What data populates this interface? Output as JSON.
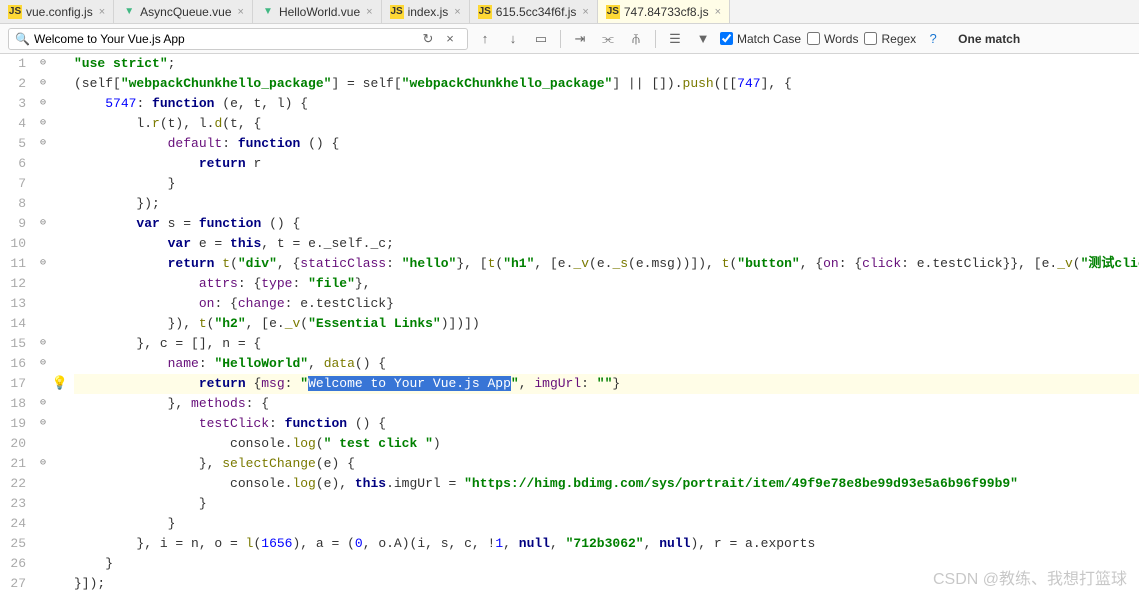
{
  "tabs": [
    {
      "icon": "js",
      "label": "vue.config.js",
      "active": false
    },
    {
      "icon": "vue",
      "label": "AsyncQueue.vue",
      "active": false
    },
    {
      "icon": "vue",
      "label": "HelloWorld.vue",
      "active": false
    },
    {
      "icon": "js",
      "label": "index.js",
      "active": false
    },
    {
      "icon": "js",
      "label": "615.5cc34f6f.js",
      "active": false
    },
    {
      "icon": "js",
      "label": "747.84733cf8.js",
      "active": true
    }
  ],
  "search": {
    "value": "Welcome to Your Vue.js App",
    "match_case_label": "Match Case",
    "words_label": "Words",
    "regex_label": "Regex",
    "match_count": "One match",
    "match_case_checked": true,
    "words_checked": false,
    "regex_checked": false
  },
  "code": {
    "lines": [
      {
        "n": 1,
        "fold": "⊖",
        "html": "<span class='s-str'>\"use strict\"</span>;"
      },
      {
        "n": 2,
        "fold": "⊖",
        "html": "(self[<span class='s-str'>\"webpackChunkhello_package\"</span>] = self[<span class='s-str'>\"webpackChunkhello_package\"</span>] || []).<span class='s-fn'>push</span>([[<span class='s-num'>747</span>], {"
      },
      {
        "n": 3,
        "fold": "⊖",
        "html": "    <span class='s-num'>5747</span>: <span class='s-kw'>function</span> (e, t, l) {"
      },
      {
        "n": 4,
        "fold": "⊖",
        "html": "        l.<span class='s-fn'>r</span>(t), l.<span class='s-fn'>d</span>(t, {"
      },
      {
        "n": 5,
        "fold": "⊖",
        "html": "            <span class='s-prop'>default</span>: <span class='s-kw'>function</span> () {"
      },
      {
        "n": 6,
        "fold": "",
        "html": "                <span class='s-kw'>return</span> r"
      },
      {
        "n": 7,
        "fold": "",
        "html": "            }"
      },
      {
        "n": 8,
        "fold": "",
        "html": "        });"
      },
      {
        "n": 9,
        "fold": "⊖",
        "html": "        <span class='s-kw'>var</span> s = <span class='s-kw'>function</span> () {"
      },
      {
        "n": 10,
        "fold": "",
        "html": "            <span class='s-kw'>var</span> e = <span class='s-kw'>this</span>, t = e._self._c;"
      },
      {
        "n": 11,
        "fold": "⊖",
        "html": "            <span class='s-kw'>return</span> <span class='s-fn'>t</span>(<span class='s-str'>\"div\"</span>, {<span class='s-prop'>staticClass</span>: <span class='s-str'>\"hello\"</span>}, [<span class='s-fn'>t</span>(<span class='s-str'>\"h1\"</span>, [e.<span class='s-fn'>_v</span>(e.<span class='s-fn'>_s</span>(e.msg))]), <span class='s-fn'>t</span>(<span class='s-str'>\"button\"</span>, {<span class='s-prop'>on</span>: {<span class='s-prop'>click</span>: e.testClick}}, [e.<span class='s-fn'>_v</span>(<span class='s-str'>\"测试click\"</span>)]), <span class='s-fn'>t</span>(<span class='s-str'>\"input\"</span>"
      },
      {
        "n": 12,
        "fold": "",
        "html": "                <span class='s-prop'>attrs</span>: {<span class='s-prop'>type</span>: <span class='s-str'>\"file\"</span>},"
      },
      {
        "n": 13,
        "fold": "",
        "html": "                <span class='s-prop'>on</span>: {<span class='s-prop'>change</span>: e.testClick}"
      },
      {
        "n": 14,
        "fold": "",
        "html": "            }), <span class='s-fn'>t</span>(<span class='s-str'>\"h2\"</span>, [e.<span class='s-fn'>_v</span>(<span class='s-str'>\"Essential Links\"</span>)])])"
      },
      {
        "n": 15,
        "fold": "⊖",
        "html": "        }, c = [], n = {"
      },
      {
        "n": 16,
        "fold": "⊖",
        "html": "            <span class='s-prop'>name</span>: <span class='s-str'>\"HelloWorld\"</span>, <span class='s-fn'>data</span>() {"
      },
      {
        "n": 17,
        "fold": "",
        "hl": true,
        "bulb": true,
        "html": "                <span class='s-kw'>return</span> {<span class='s-prop'>msg</span>: <span class='s-str'>\"</span><span class='s-sel'>Welcome to Your Vue.js App</span><span class='s-str'>\"</span>, <span class='s-prop'>imgUrl</span>: <span class='s-str'>\"\"</span>}"
      },
      {
        "n": 18,
        "fold": "⊖",
        "html": "            }, <span class='s-prop'>methods</span>: {"
      },
      {
        "n": 19,
        "fold": "⊖",
        "html": "                <span class='s-prop'>testClick</span>: <span class='s-kw'>function</span> () {"
      },
      {
        "n": 20,
        "fold": "",
        "html": "                    console.<span class='s-fn'>log</span>(<span class='s-str'>\" test click \"</span>)"
      },
      {
        "n": 21,
        "fold": "⊖",
        "html": "                }, <span class='s-fn'>selectChange</span>(e) {"
      },
      {
        "n": 22,
        "fold": "",
        "html": "                    console.<span class='s-fn'>log</span>(e), <span class='s-kw'>this</span>.imgUrl = <span class='s-str'>\"https://himg.bdimg.com/sys/portrait/item/49f9e78e8be99d93e5a6b96f99b9\"</span>"
      },
      {
        "n": 23,
        "fold": "",
        "html": "                }"
      },
      {
        "n": 24,
        "fold": "",
        "html": "            }"
      },
      {
        "n": 25,
        "fold": "",
        "html": "        }, i = n, o = <span class='s-fn'>l</span>(<span class='s-num'>1656</span>), a = (<span class='s-num'>0</span>, o.A)(i, s, c, !<span class='s-num'>1</span>, <span class='s-kw'>null</span>, <span class='s-str'>\"712b3062\"</span>, <span class='s-kw'>null</span>), r = a.exports"
      },
      {
        "n": 26,
        "fold": "",
        "html": "    }"
      },
      {
        "n": 27,
        "fold": "",
        "html": "}]);"
      }
    ]
  },
  "watermark": "CSDN @教练、我想打篮球"
}
